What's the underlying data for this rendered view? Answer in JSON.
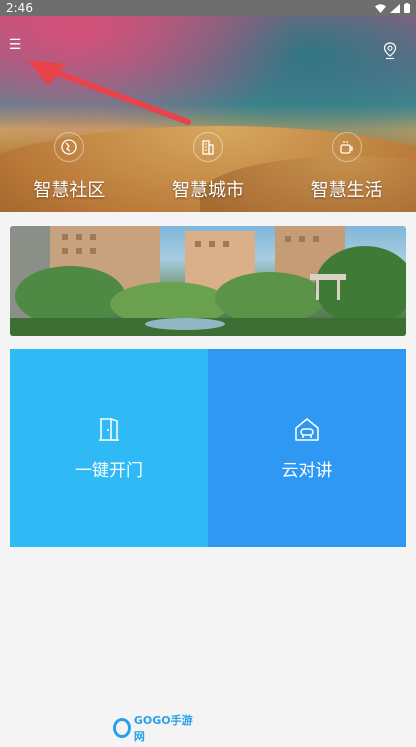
{
  "status_bar": {
    "time": "2:46",
    "icons": [
      "wifi-icon",
      "signal-icon",
      "battery-icon"
    ]
  },
  "header": {
    "menu_icon": "menu-icon",
    "location_icon": "location-icon",
    "categories": [
      {
        "label": "智慧社区",
        "icon": "community-icon"
      },
      {
        "label": "智慧城市",
        "icon": "city-building-icon"
      },
      {
        "label": "智慧生活",
        "icon": "coffee-cup-icon"
      }
    ]
  },
  "tiles": [
    {
      "label": "一键开门",
      "icon": "door-icon",
      "color": "#2fbaf6"
    },
    {
      "label": "云对讲",
      "icon": "intercom-icon",
      "color": "#2e98f2"
    }
  ],
  "watermark": {
    "text": "GOGO手游网"
  },
  "colors": {
    "annotation_arrow": "#e8434a",
    "tile_left": "#2fbaf6",
    "tile_right": "#2e98f2"
  }
}
